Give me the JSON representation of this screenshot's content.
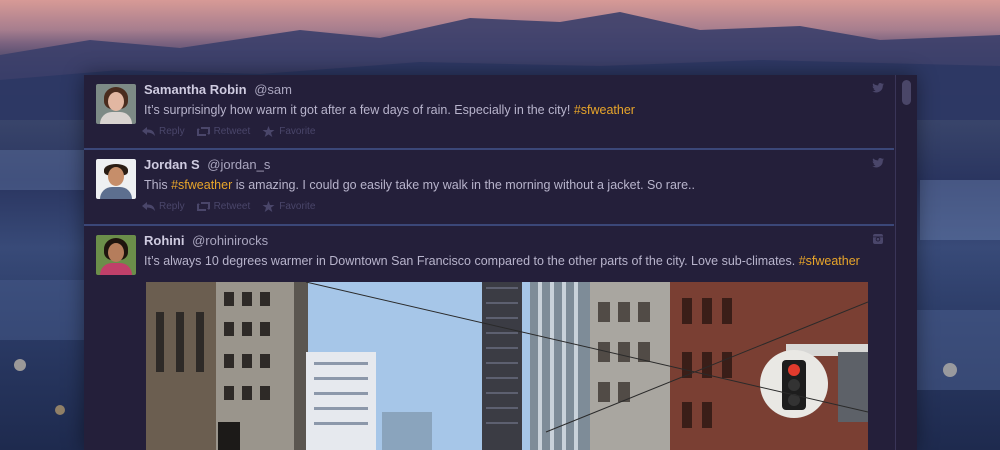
{
  "window": {
    "title": ""
  },
  "tweets": [
    {
      "name": "Samantha Robin",
      "handle": "@sam",
      "text_before": "It’s surprisingly how warm it got after a few days of rain. Especially in the city! ",
      "hashtag": "#sfweather",
      "text_after": "",
      "service_icon": "twitter-icon"
    },
    {
      "name": "Jordan S",
      "handle": "@jordan_s",
      "text_before": "This ",
      "hashtag": "#sfweather",
      "text_after": " is amazing. I could go easily take my walk in the morning without a jacket. So rare..",
      "service_icon": "twitter-icon"
    },
    {
      "name": "Rohini",
      "handle": "@rohinirocks",
      "text_before": "It’s always 10 degrees warmer in Downtown San Francisco compared to the other parts of the city. Love sub-climates. ",
      "hashtag": "#sfweather",
      "text_after": "",
      "service_icon": "instagram-icon"
    }
  ],
  "actions": {
    "reply": "Reply",
    "retweet": "Retweet",
    "favorite": "Favorite"
  },
  "colors": {
    "panel": "#241f3a",
    "hashtag": "#e8a52a",
    "divider": "#3b4778",
    "action": "#4a466a"
  }
}
